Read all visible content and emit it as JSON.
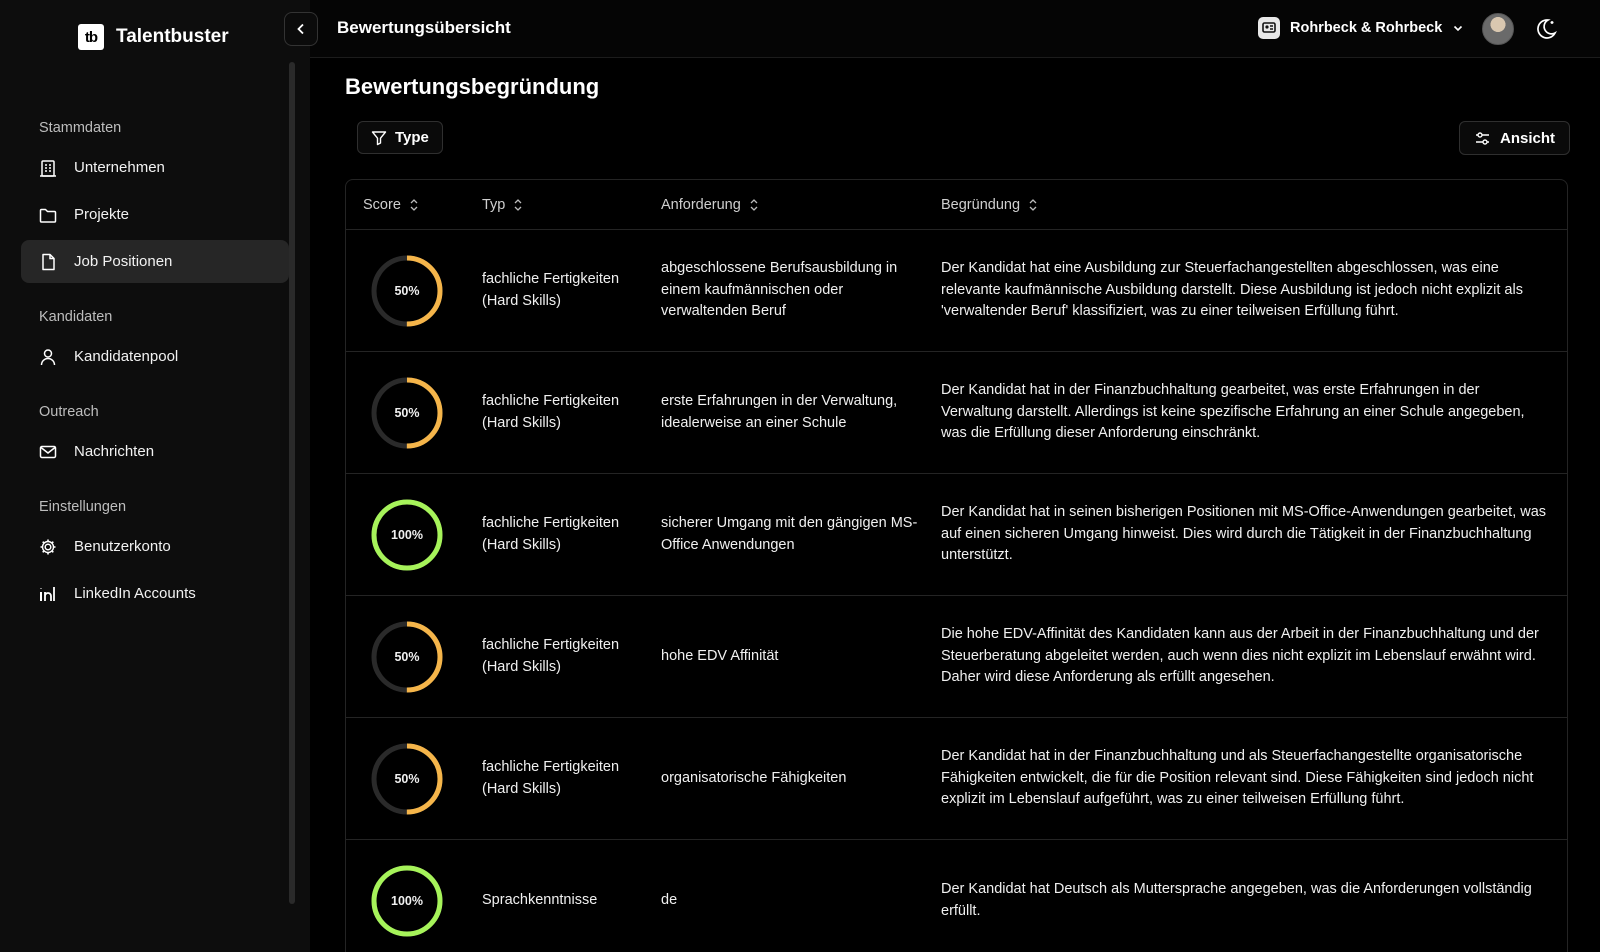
{
  "brand": {
    "logo_text": "tb",
    "name": "Talentbuster"
  },
  "sidebar": {
    "sections": [
      {
        "title": "Stammdaten",
        "items": [
          {
            "label": "Unternehmen",
            "icon": "building-icon",
            "active": false
          },
          {
            "label": "Projekte",
            "icon": "folder-icon",
            "active": false
          },
          {
            "label": "Job Positionen",
            "icon": "file-icon",
            "active": true
          }
        ]
      },
      {
        "title": "Kandidaten",
        "items": [
          {
            "label": "Kandidatenpool",
            "icon": "user-icon",
            "active": false
          }
        ]
      },
      {
        "title": "Outreach",
        "items": [
          {
            "label": "Nachrichten",
            "icon": "mail-icon",
            "active": false
          }
        ]
      },
      {
        "title": "Einstellungen",
        "items": [
          {
            "label": "Benutzerkonto",
            "icon": "gear-icon",
            "active": false
          },
          {
            "label": "LinkedIn Accounts",
            "icon": "linkedin-icon",
            "active": false
          }
        ]
      }
    ]
  },
  "header": {
    "title": "Bewertungsübersicht",
    "company": "Rohrbeck & Rohrbeck"
  },
  "main": {
    "title": "Bewertungsbegründung",
    "filter_label": "Type",
    "view_label": "Ansicht",
    "columns": [
      "Score",
      "Typ",
      "Anforderung",
      "Begründung"
    ],
    "rows": [
      {
        "score": 50,
        "score_label": "50%",
        "typ": "fachliche Fertigkeiten (Hard Skills)",
        "anforderung": "abgeschlossene Berufsausbildung in einem kaufmännischen oder verwaltenden Beruf",
        "begruendung": "Der Kandidat hat eine Ausbildung zur Steuerfachangestellten abgeschlossen, was eine relevante kaufmännische Ausbildung darstellt. Diese Ausbildung ist jedoch nicht explizit als 'verwaltender Beruf' klassifiziert, was zu einer teilweisen Erfüllung führt."
      },
      {
        "score": 50,
        "score_label": "50%",
        "typ": "fachliche Fertigkeiten (Hard Skills)",
        "anforderung": "erste Erfahrungen in der Verwaltung, idealerweise an einer Schule",
        "begruendung": "Der Kandidat hat in der Finanzbuchhaltung gearbeitet, was erste Erfahrungen in der Verwaltung darstellt. Allerdings ist keine spezifische Erfahrung an einer Schule angegeben, was die Erfüllung dieser Anforderung einschränkt."
      },
      {
        "score": 100,
        "score_label": "100%",
        "typ": "fachliche Fertigkeiten (Hard Skills)",
        "anforderung": "sicherer Umgang mit den gängigen MS-Office Anwendungen",
        "begruendung": "Der Kandidat hat in seinen bisherigen Positionen mit MS-Office-Anwendungen gearbeitet, was auf einen sicheren Umgang hinweist. Dies wird durch die Tätigkeit in der Finanzbuchhaltung unterstützt."
      },
      {
        "score": 50,
        "score_label": "50%",
        "typ": "fachliche Fertigkeiten (Hard Skills)",
        "anforderung": "hohe EDV Affinität",
        "begruendung": "Die hohe EDV-Affinität des Kandidaten kann aus der Arbeit in der Finanzbuchhaltung und der Steuerberatung abgeleitet werden, auch wenn dies nicht explizit im Lebenslauf erwähnt wird. Daher wird diese Anforderung als erfüllt angesehen."
      },
      {
        "score": 50,
        "score_label": "50%",
        "typ": "fachliche Fertigkeiten (Hard Skills)",
        "anforderung": "organisatorische Fähigkeiten",
        "begruendung": "Der Kandidat hat in der Finanzbuchhaltung und als Steuerfachangestellte organisatorische Fähigkeiten entwickelt, die für die Position relevant sind. Diese Fähigkeiten sind jedoch nicht explizit im Lebenslauf aufgeführt, was zu einer teilweisen Erfüllung führt."
      },
      {
        "score": 100,
        "score_label": "100%",
        "typ": "Sprachkenntnisse",
        "anforderung": "de",
        "begruendung": "Der Kandidat hat Deutsch als Muttersprache angegeben, was die Anforderungen vollständig erfüllt."
      }
    ]
  },
  "colors": {
    "partial": "#f5b54a",
    "full": "#a6f35a",
    "track": "#2a2a2a"
  }
}
